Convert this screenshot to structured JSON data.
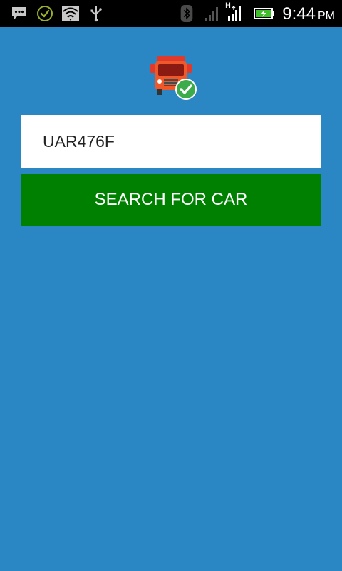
{
  "status_bar": {
    "time": "9:44",
    "ampm": "PM",
    "network_label": "H",
    "icons": [
      "message-icon",
      "check-circle-icon",
      "wifi-icon",
      "usb-icon",
      "bluetooth-icon",
      "signal-icon",
      "mobile-data-icon",
      "battery-charging-icon"
    ]
  },
  "search": {
    "value": "UAR476F",
    "button_label": "SEARCH FOR CAR"
  },
  "colors": {
    "background": "#2b87c3",
    "button": "#008000",
    "status_bar": "#000000"
  }
}
